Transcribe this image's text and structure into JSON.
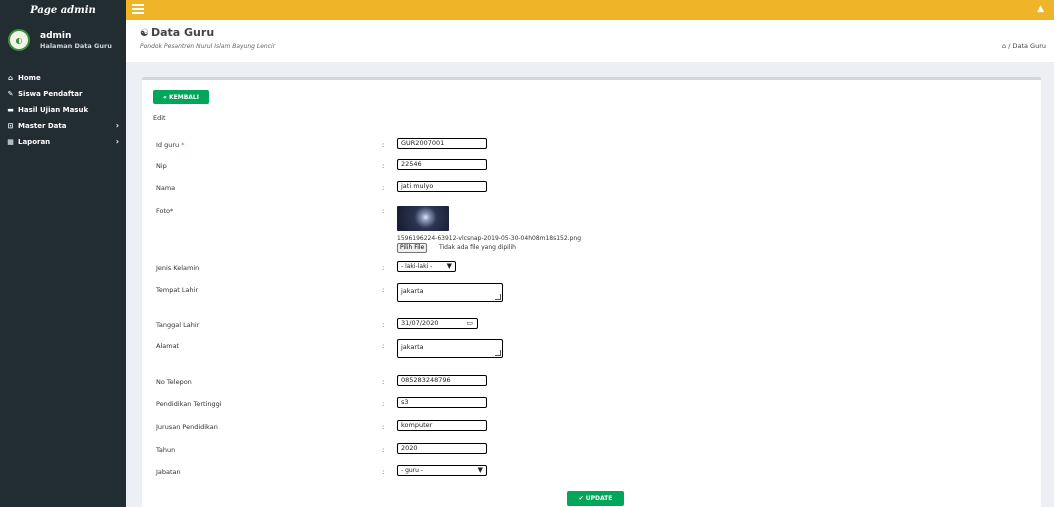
{
  "app": {
    "brand": "Page admin"
  },
  "sidebar": {
    "user_name": "admin",
    "user_role": "Halaman Data Guru",
    "items": [
      {
        "label": "Home",
        "icon": "⌂"
      },
      {
        "label": "Siswa Pendaftar",
        "icon": "✎"
      },
      {
        "label": "Hasil Ujian Masuk",
        "icon": "▬"
      },
      {
        "label": "Master Data",
        "icon": "⊡"
      },
      {
        "label": "Laporan",
        "icon": "▦"
      }
    ]
  },
  "header": {
    "title": "Data Guru",
    "subtitle": "Pondok Pesantren Nurul Islam Bayung Lencir",
    "breadcrumb": "/ Data Guru"
  },
  "form": {
    "back_label": "KEMBALI",
    "mode_label": "Edit",
    "fields": {
      "id_guru": {
        "label": "Id guru",
        "required": "*",
        "value": "GUR2007001"
      },
      "nip": {
        "label": "Nip",
        "value": "22546"
      },
      "nama": {
        "label": "Nama",
        "value": "jati mulyo"
      },
      "foto": {
        "label": "Foto*",
        "filename": "1596196224-63912-vlcsnap-2019-05-30-04h08m18s152.png",
        "button": "Pilih File",
        "status": "Tidak ada file yang dipilih"
      },
      "jenis_kelamin": {
        "label": "Jenis Kelamin",
        "value": "- laki-laki -"
      },
      "tempat_lahir": {
        "label": "Tempat Lahir",
        "value": "jakarta"
      },
      "tanggal_lahir": {
        "label": "Tanggal Lahir",
        "value": "31/07/2020"
      },
      "alamat": {
        "label": "Alamat",
        "value": "jakarta"
      },
      "no_telepon": {
        "label": "No Telepon",
        "value": "085283248796"
      },
      "pendidikan": {
        "label": "Pendidikan Tertinggi",
        "value": "s3"
      },
      "jurusan": {
        "label": "Jurusan Pendidikan",
        "value": "komputer"
      },
      "tahun": {
        "label": "Tahun",
        "value": "2020"
      },
      "jabatan": {
        "label": "Jabatan",
        "value": "- guru -"
      }
    },
    "separator": ":",
    "update_label": "UPDATE"
  },
  "colors": {
    "topbar": "#f0b429",
    "sidebar": "#222d32",
    "button": "#00a65a",
    "content_bg": "#ecf0f5"
  }
}
